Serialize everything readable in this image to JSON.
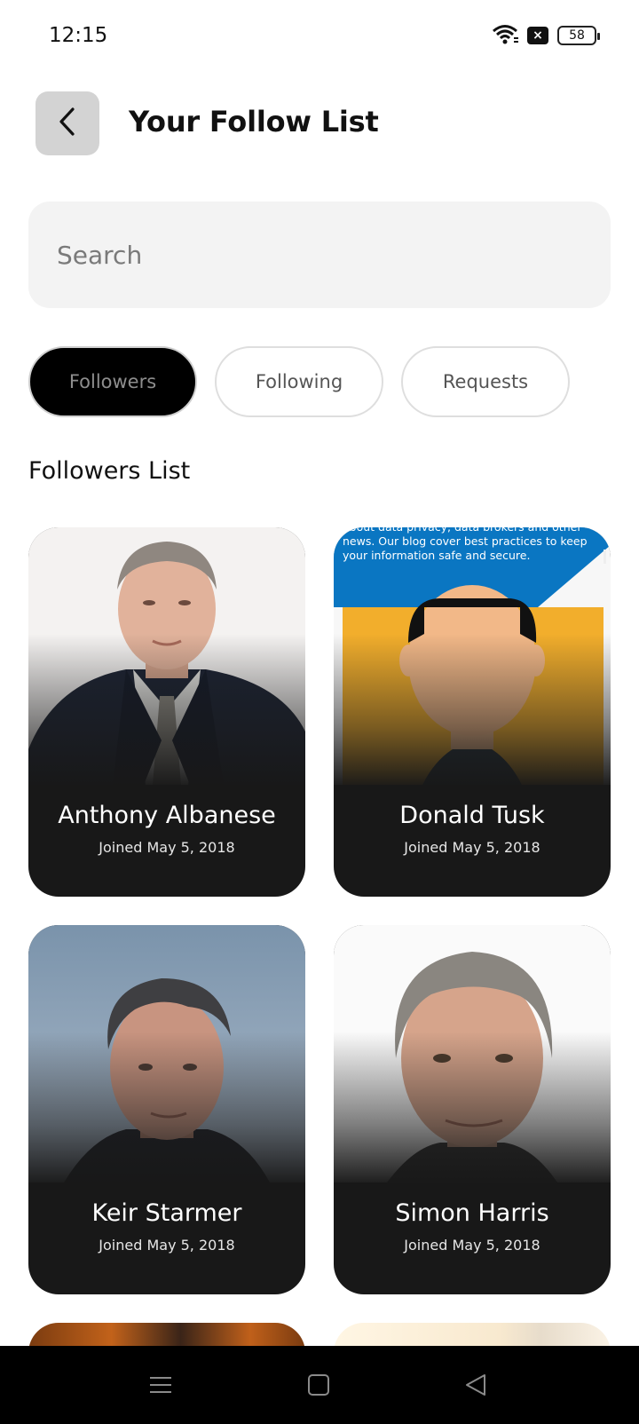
{
  "status_bar": {
    "time": "12:15",
    "battery": "58",
    "notification_badge": "×",
    "icons": [
      "wifi-icon",
      "notification-x-icon",
      "battery-icon"
    ]
  },
  "header": {
    "back_icon": "chevron-left-icon",
    "title": "Your Follow List"
  },
  "search": {
    "placeholder": "Search",
    "value": ""
  },
  "tabs": [
    {
      "label": "Followers",
      "active": true
    },
    {
      "label": "Following",
      "active": false
    },
    {
      "label": "Requests",
      "active": false
    }
  ],
  "section_title": "Followers List",
  "followers": [
    {
      "name": "Anthony Albanese",
      "joined": "Joined May 5, 2018"
    },
    {
      "name": "Donald Tusk",
      "joined": "Joined May 5, 2018",
      "banner_text": "about data privacy, data brokers and other news. Our blog cover best practices to keep your information safe and secure."
    },
    {
      "name": "Keir Starmer",
      "joined": "Joined May 5, 2018"
    },
    {
      "name": "Simon Harris",
      "joined": "Joined May 5, 2018"
    }
  ],
  "nav": {
    "icons": [
      "menu-icon",
      "home-square-icon",
      "back-triangle-icon"
    ]
  },
  "colors": {
    "active_tab_bg": "#000000",
    "card_bg": "#181818",
    "search_bg": "#f3f3f3",
    "back_button_bg": "#d3d3d3",
    "banner_blue": "#0a76c2",
    "avatar_yellow": "#f2ae2c"
  }
}
